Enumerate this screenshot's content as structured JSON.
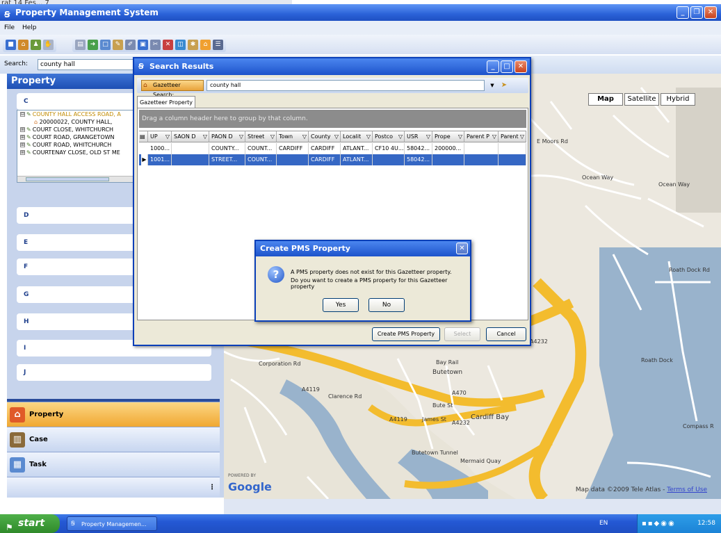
{
  "background": {
    "corner_text": "rat 14 Fes...  7"
  },
  "app": {
    "title": "Property Management System",
    "minimize": "_",
    "restore": "❐",
    "close": "✕"
  },
  "menu": {
    "items": [
      "File",
      "Help"
    ]
  },
  "search": {
    "label": "Search:",
    "value": "county hall"
  },
  "left_panel": {
    "header": "Property",
    "letters": [
      "C",
      "D",
      "E",
      "F",
      "G",
      "H",
      "I",
      "J"
    ],
    "tree": [
      {
        "text": "COUNTY HALL ACCESS ROAD, A",
        "style": "sel",
        "expander": "⊟"
      },
      {
        "text": "20000022, COUNTY HALL, ",
        "style": "blue",
        "expander": ""
      },
      {
        "text": "COURT CLOSE, WHITCHURCH",
        "style": "green",
        "expander": "⊞"
      },
      {
        "text": "COURT ROAD, GRANGETOWN",
        "style": "green",
        "expander": "⊞"
      },
      {
        "text": "COURT ROAD, WHITCHURCH",
        "style": "green",
        "expander": "⊞"
      },
      {
        "text": "COURTENAY CLOSE, OLD ST ME",
        "style": "green",
        "expander": "⊞"
      }
    ],
    "nav": [
      {
        "label": "Property",
        "icon": "house-icon"
      },
      {
        "label": "Case",
        "icon": "box-icon"
      },
      {
        "label": "Task",
        "icon": "calendar-icon"
      }
    ]
  },
  "search_dialog": {
    "title": "Search Results",
    "gazetteer_button": "Gazetteer Search:",
    "gazetteer_value": "county hall",
    "tab": "Gazetteer Property",
    "group_hint": "Drag a column header here to group by that column.",
    "columns": [
      "UP",
      "SAON D",
      "PAON D",
      "Street",
      "Town",
      "County",
      "Localit",
      "Postco",
      "USR",
      "Prope",
      "Parent P",
      "Parent"
    ],
    "rows": [
      [
        "1000...",
        "",
        "COUNTY...",
        "COUNT...",
        "CARDIFF",
        "CARDIFF",
        "ATLANT...",
        "CF10 4U...",
        "58042...",
        "200000...",
        "",
        ""
      ],
      [
        "1001...",
        "",
        "STREET...",
        "COUNT...",
        "",
        "CARDIFF",
        "ATLANT...",
        "",
        "58042...",
        "",
        "",
        ""
      ]
    ],
    "row_marker": "▶",
    "buttons": {
      "create": "Create PMS Property",
      "select": "Select",
      "cancel": "Cancel"
    }
  },
  "pms_dialog": {
    "title": "Create PMS Property",
    "close": "✕",
    "icon": "?",
    "message_line1": "A PMS property does not exist for this Gazetteer property.",
    "message_line2": "Do you want to create a PMS property for this Gazetteer property",
    "yes": "Yes",
    "no": "No"
  },
  "map": {
    "types": [
      "Map",
      "Satellite",
      "Hybrid"
    ],
    "powered_by": "POWERED BY",
    "google": "Google",
    "data_text": "Map data ©2009 Tele Atlas - ",
    "terms": "Terms of Use",
    "labels": [
      "Ocean Way",
      "Ocean Way",
      "Roath Dock Rd",
      "Roath Dock",
      "Clarence Rd",
      "Bute St",
      "James St",
      "Cardiff Bay",
      "Butetown",
      "Bay Rail",
      "A4119",
      "A4119",
      "A470",
      "A4232",
      "A4232",
      "Mermaid Quay",
      "Corporation Rd",
      "Compass R",
      "E Moors Rd",
      "Butetown Tunnel"
    ]
  },
  "taskbar": {
    "start": "start",
    "task_item": "Property Managemen...",
    "lang": "EN",
    "clock": "12:58"
  }
}
